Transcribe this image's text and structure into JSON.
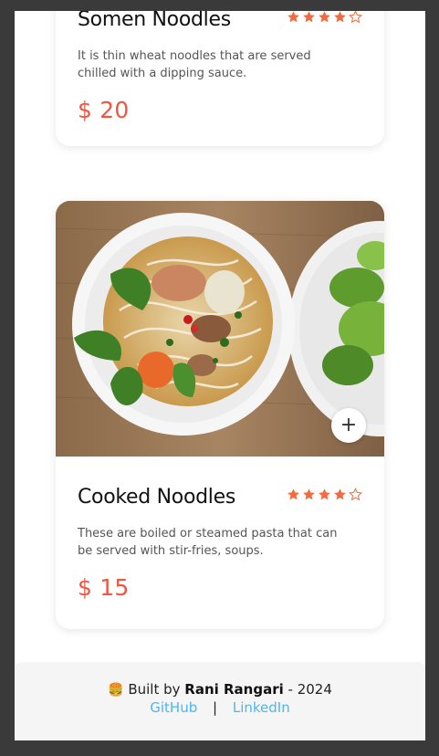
{
  "cards": [
    {
      "title": "Somen Noodles",
      "description": "It is thin wheat noodles that are served chilled with a dipping sauce.",
      "price": "$ 20",
      "rating_filled": 4,
      "rating_max": 5
    },
    {
      "title": "Cooked Noodles",
      "description": "These are boiled or steamed pasta that can be served with stir-fries, soups.",
      "price": "$ 15",
      "rating_filled": 4,
      "rating_max": 5,
      "add_label": "+"
    }
  ],
  "footer": {
    "emoji": "🍔",
    "built_by": "Built by",
    "author": "Rani Rangari",
    "year_suffix": "- 2024",
    "github": "GitHub",
    "separator": "|",
    "linkedin": "LinkedIn"
  },
  "colors": {
    "accent": "#f0563f",
    "star": "#f26a3d",
    "link": "#4fb6ef",
    "backdrop": "#3a3a3a"
  },
  "icons": {
    "rating": "star-icon",
    "add": "plus-icon",
    "footer": "hamburger-emoji-icon"
  }
}
